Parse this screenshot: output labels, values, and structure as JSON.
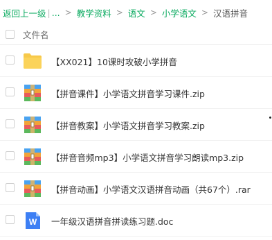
{
  "breadcrumb": {
    "back_label": "返回上一级",
    "pipe": "|",
    "ellipsis": "...",
    "separator": ">",
    "items": [
      "教学资料",
      "语文",
      "小学语文"
    ],
    "current": "汉语拼音"
  },
  "header": {
    "column_label": "文件名"
  },
  "files": [
    {
      "name": "【XX021】10课时攻破小学拼音",
      "type": "folder",
      "icon": "folder-icon"
    },
    {
      "name": "【拼音课件】小学语文拼音学习课件.zip",
      "type": "zip",
      "icon": "archive-icon"
    },
    {
      "name": "【拼音教案】小学语文拼音学习教案.zip",
      "type": "zip",
      "icon": "archive-icon"
    },
    {
      "name": "【拼音音频mp3】小学语文拼音学习朗读mp3.zip",
      "type": "zip",
      "icon": "archive-icon"
    },
    {
      "name": "【拼音动画】小学语文汉语拼音动画（共67个）.rar",
      "type": "rar",
      "icon": "archive-icon"
    },
    {
      "name": "一年级汉语拼音拼读练习题.doc",
      "type": "doc",
      "icon": "word-doc-icon",
      "icon_letter": "W"
    }
  ],
  "colors": {
    "link": "#09aa5f",
    "folder": "#f7c94a",
    "word": "#3d7ff4"
  }
}
